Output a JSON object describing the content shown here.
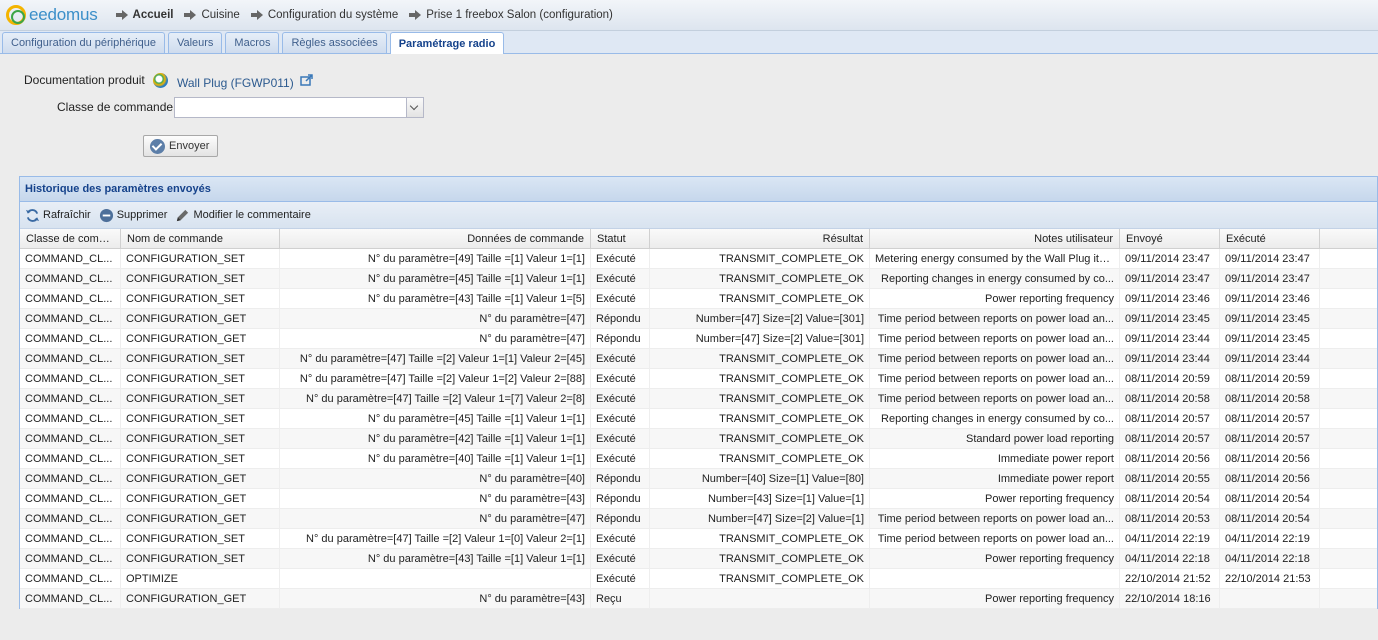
{
  "header": {
    "logo_text": "eedomus",
    "breadcrumbs": [
      "Accueil",
      "Cuisine",
      "Configuration du système",
      "Prise 1 freebox Salon (configuration)"
    ]
  },
  "tabs": [
    {
      "label": "Configuration du périphérique",
      "active": false
    },
    {
      "label": "Valeurs",
      "active": false
    },
    {
      "label": "Macros",
      "active": false
    },
    {
      "label": "Règles associées",
      "active": false
    },
    {
      "label": "Paramétrage radio",
      "active": true
    }
  ],
  "form": {
    "doc_label": "Documentation produit",
    "doc_link": "Wall Plug (FGWP011)",
    "command_class_label": "Classe de commande",
    "command_class_value": "",
    "send_label": "Envoyer"
  },
  "panel": {
    "title": "Historique des paramètres envoyés",
    "toolbar": {
      "refresh": "Rafraîchir",
      "delete": "Supprimer",
      "edit_comment": "Modifier le commentaire"
    },
    "columns": [
      "Classe de comm...",
      "Nom de commande",
      "Données de commande",
      "Statut",
      "Résultat",
      "Notes utilisateur",
      "Envoyé",
      "Exécuté"
    ],
    "rows": [
      [
        "COMMAND_CL...",
        "CONFIGURATION_SET",
        "N° du paramètre=[49] Taille =[1] Valeur 1=[1]",
        "Exécuté",
        "TRANSMIT_COMPLETE_OK",
        "Metering energy consumed by the Wall Plug itself",
        "09/11/2014 23:47",
        "09/11/2014 23:47"
      ],
      [
        "COMMAND_CL...",
        "CONFIGURATION_SET",
        "N° du paramètre=[45] Taille =[1] Valeur 1=[1]",
        "Exécuté",
        "TRANSMIT_COMPLETE_OK",
        "Reporting changes in energy consumed by co...",
        "09/11/2014 23:47",
        "09/11/2014 23:47"
      ],
      [
        "COMMAND_CL...",
        "CONFIGURATION_SET",
        "N° du paramètre=[43] Taille =[1] Valeur 1=[5]",
        "Exécuté",
        "TRANSMIT_COMPLETE_OK",
        "Power reporting frequency",
        "09/11/2014 23:46",
        "09/11/2014 23:46"
      ],
      [
        "COMMAND_CL...",
        "CONFIGURATION_GET",
        "N° du paramètre=[47]",
        "Répondu",
        "Number=[47] Size=[2] Value=[301]",
        "Time period between reports on power load an...",
        "09/11/2014 23:45",
        "09/11/2014 23:45"
      ],
      [
        "COMMAND_CL...",
        "CONFIGURATION_GET",
        "N° du paramètre=[47]",
        "Répondu",
        "Number=[47] Size=[2] Value=[301]",
        "Time period between reports on power load an...",
        "09/11/2014 23:44",
        "09/11/2014 23:45"
      ],
      [
        "COMMAND_CL...",
        "CONFIGURATION_SET",
        "N° du paramètre=[47] Taille =[2] Valeur 1=[1] Valeur 2=[45]",
        "Exécuté",
        "TRANSMIT_COMPLETE_OK",
        "Time period between reports on power load an...",
        "09/11/2014 23:44",
        "09/11/2014 23:44"
      ],
      [
        "COMMAND_CL...",
        "CONFIGURATION_SET",
        "N° du paramètre=[47] Taille =[2] Valeur 1=[2] Valeur 2=[88]",
        "Exécuté",
        "TRANSMIT_COMPLETE_OK",
        "Time period between reports on power load an...",
        "08/11/2014 20:59",
        "08/11/2014 20:59"
      ],
      [
        "COMMAND_CL...",
        "CONFIGURATION_SET",
        "N° du paramètre=[47] Taille =[2] Valeur 1=[7] Valeur 2=[8]",
        "Exécuté",
        "TRANSMIT_COMPLETE_OK",
        "Time period between reports on power load an...",
        "08/11/2014 20:58",
        "08/11/2014 20:58"
      ],
      [
        "COMMAND_CL...",
        "CONFIGURATION_SET",
        "N° du paramètre=[45] Taille =[1] Valeur 1=[1]",
        "Exécuté",
        "TRANSMIT_COMPLETE_OK",
        "Reporting changes in energy consumed by co...",
        "08/11/2014 20:57",
        "08/11/2014 20:57"
      ],
      [
        "COMMAND_CL...",
        "CONFIGURATION_SET",
        "N° du paramètre=[42] Taille =[1] Valeur 1=[1]",
        "Exécuté",
        "TRANSMIT_COMPLETE_OK",
        "Standard power load reporting",
        "08/11/2014 20:57",
        "08/11/2014 20:57"
      ],
      [
        "COMMAND_CL...",
        "CONFIGURATION_SET",
        "N° du paramètre=[40] Taille =[1] Valeur 1=[1]",
        "Exécuté",
        "TRANSMIT_COMPLETE_OK",
        "Immediate power report",
        "08/11/2014 20:56",
        "08/11/2014 20:56"
      ],
      [
        "COMMAND_CL...",
        "CONFIGURATION_GET",
        "N° du paramètre=[40]",
        "Répondu",
        "Number=[40] Size=[1] Value=[80]",
        "Immediate power report",
        "08/11/2014 20:55",
        "08/11/2014 20:56"
      ],
      [
        "COMMAND_CL...",
        "CONFIGURATION_GET",
        "N° du paramètre=[43]",
        "Répondu",
        "Number=[43] Size=[1] Value=[1]",
        "Power reporting frequency",
        "08/11/2014 20:54",
        "08/11/2014 20:54"
      ],
      [
        "COMMAND_CL...",
        "CONFIGURATION_GET",
        "N° du paramètre=[47]",
        "Répondu",
        "Number=[47] Size=[2] Value=[1]",
        "Time period between reports on power load an...",
        "08/11/2014 20:53",
        "08/11/2014 20:54"
      ],
      [
        "COMMAND_CL...",
        "CONFIGURATION_SET",
        "N° du paramètre=[47] Taille =[2] Valeur 1=[0] Valeur 2=[1]",
        "Exécuté",
        "TRANSMIT_COMPLETE_OK",
        "Time period between reports on power load an...",
        "04/11/2014 22:19",
        "04/11/2014 22:19"
      ],
      [
        "COMMAND_CL...",
        "CONFIGURATION_SET",
        "N° du paramètre=[43] Taille =[1] Valeur 1=[1]",
        "Exécuté",
        "TRANSMIT_COMPLETE_OK",
        "Power reporting frequency",
        "04/11/2014 22:18",
        "04/11/2014 22:18"
      ],
      [
        "COMMAND_CL...",
        "OPTIMIZE",
        "",
        "Exécuté",
        "TRANSMIT_COMPLETE_OK",
        "",
        "22/10/2014 21:52",
        "22/10/2014 21:53"
      ],
      [
        "COMMAND_CL...",
        "CONFIGURATION_GET",
        "N° du paramètre=[43]",
        "Reçu",
        "",
        "Power reporting frequency",
        "22/10/2014 18:16",
        ""
      ]
    ]
  }
}
